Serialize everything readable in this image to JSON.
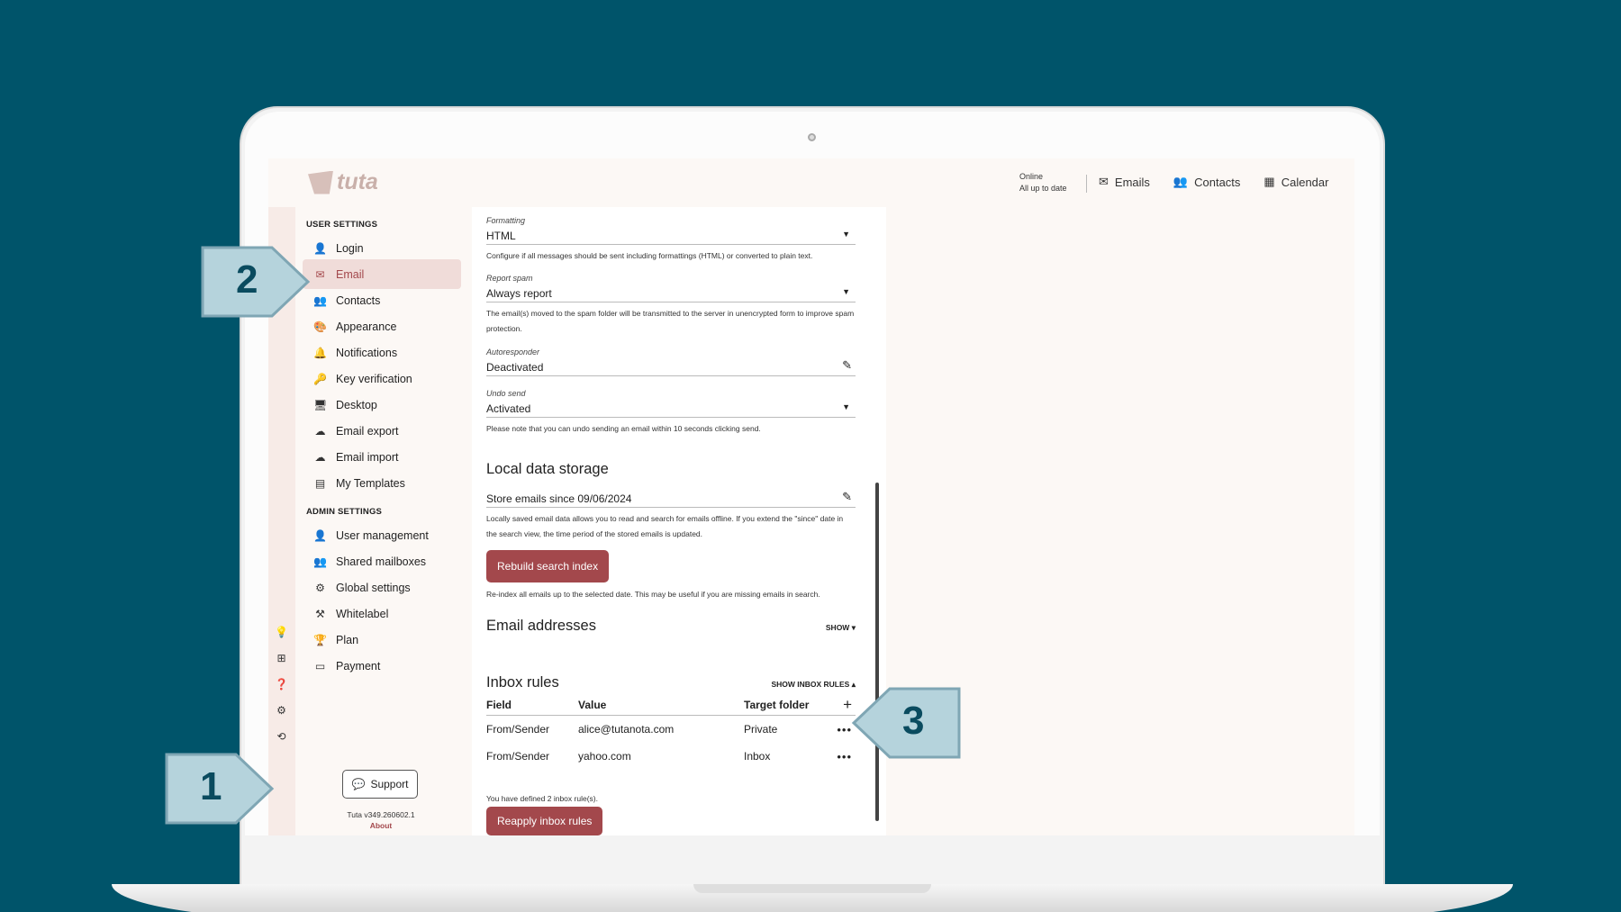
{
  "app": {
    "logo_text": "tuta",
    "status_line1": "Online",
    "status_line2": "All up to date",
    "nav": [
      {
        "label": "Emails",
        "icon": "envelope-icon"
      },
      {
        "label": "Contacts",
        "icon": "people-icon"
      },
      {
        "label": "Calendar",
        "icon": "calendar-icon"
      }
    ]
  },
  "sidebar": {
    "user_settings_title": "USER SETTINGS",
    "user_items": [
      {
        "label": "Login",
        "icon": "person-icon"
      },
      {
        "label": "Email",
        "icon": "envelope-icon",
        "active": true
      },
      {
        "label": "Contacts",
        "icon": "people-icon"
      },
      {
        "label": "Appearance",
        "icon": "palette-icon"
      },
      {
        "label": "Notifications",
        "icon": "bell-icon"
      },
      {
        "label": "Key verification",
        "icon": "key-icon"
      },
      {
        "label": "Desktop",
        "icon": "monitor-icon"
      },
      {
        "label": "Email export",
        "icon": "cloud-download-icon"
      },
      {
        "label": "Email import",
        "icon": "cloud-upload-icon"
      },
      {
        "label": "My Templates",
        "icon": "template-icon"
      }
    ],
    "admin_settings_title": "ADMIN SETTINGS",
    "admin_items": [
      {
        "label": "User management",
        "icon": "person-icon"
      },
      {
        "label": "Shared mailboxes",
        "icon": "people-icon"
      },
      {
        "label": "Global settings",
        "icon": "gear-icon"
      },
      {
        "label": "Whitelabel",
        "icon": "wand-icon"
      },
      {
        "label": "Plan",
        "icon": "trophy-icon"
      },
      {
        "label": "Payment",
        "icon": "credit-card-icon"
      }
    ],
    "support_label": "Support",
    "version": "Tuta v349.260602.1",
    "about": "About"
  },
  "content": {
    "formatting": {
      "label": "Formatting",
      "value": "HTML",
      "help": "Configure if all messages should be sent including formattings (HTML) or converted to plain text."
    },
    "report_spam": {
      "label": "Report spam",
      "value": "Always report",
      "help": "The email(s) moved to the spam folder will be transmitted to the server in unencrypted form to improve spam protection."
    },
    "autoresponder": {
      "label": "Autoresponder",
      "value": "Deactivated"
    },
    "undo_send": {
      "label": "Undo send",
      "value": "Activated",
      "help": "Please note that you can undo sending an email within 10 seconds clicking send."
    },
    "local_storage": {
      "heading": "Local data storage",
      "value": "Store emails since 09/06/2024",
      "help": "Locally saved email data allows you to read and search for emails offline. If you extend the \"since\" date in the search view, the time period of the stored emails is updated.",
      "rebuild_button": "Rebuild search index",
      "rebuild_help": "Re-index all emails up to the selected date. This may be useful if you are missing emails in search."
    },
    "email_addresses": {
      "heading": "Email addresses",
      "show": "SHOW"
    },
    "inbox_rules": {
      "heading": "Inbox rules",
      "show": "SHOW INBOX RULES",
      "columns": [
        "Field",
        "Value",
        "Target folder"
      ],
      "rows": [
        {
          "field": "From/Sender",
          "value": "alice@tutanota.com",
          "folder": "Private"
        },
        {
          "field": "From/Sender",
          "value": "yahoo.com",
          "folder": "Inbox"
        }
      ],
      "count_text": "You have defined 2 inbox rule(s).",
      "reapply_button": "Reapply inbox rules"
    }
  },
  "callouts": [
    "1",
    "2",
    "3"
  ]
}
